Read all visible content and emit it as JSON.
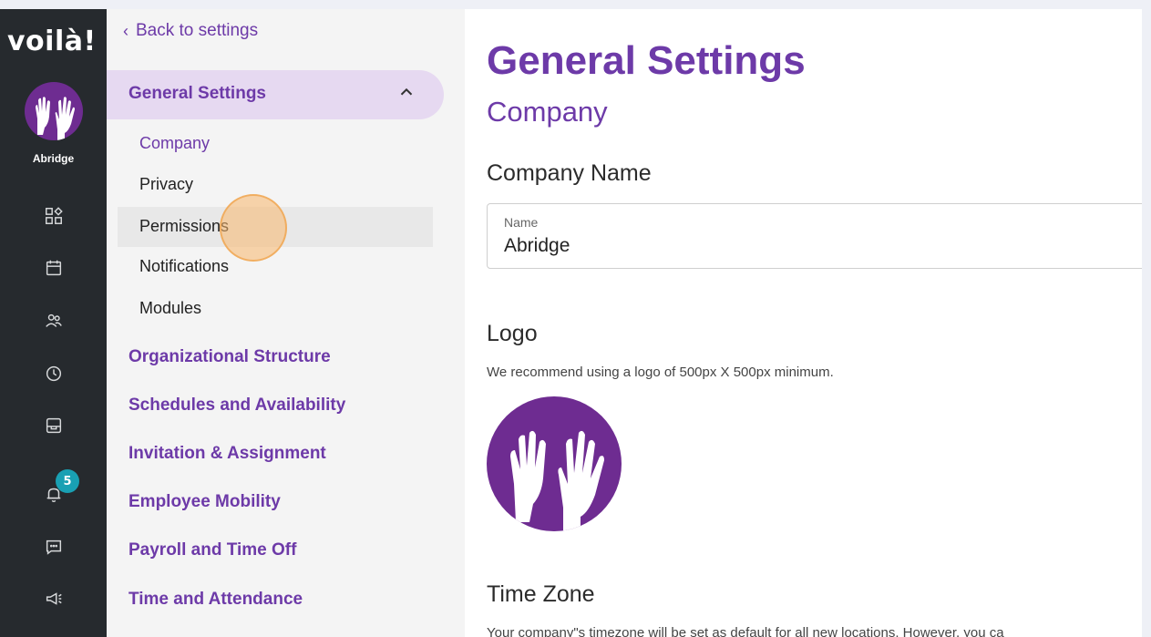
{
  "rail": {
    "logo_text": "voilà!",
    "company_short": "Abridge",
    "icons": [
      "dashboard-icon",
      "calendar-icon",
      "people-icon",
      "clock-icon",
      "inbox-icon",
      "bell-icon",
      "chat-icon",
      "megaphone-icon"
    ],
    "notification_count": "5"
  },
  "sidebar": {
    "back_label": "Back to settings",
    "group_title": "General Settings",
    "sub_items": [
      "Company",
      "Privacy",
      "Permissions",
      "Notifications",
      "Modules"
    ],
    "sections": [
      "Organizational Structure",
      "Schedules and Availability",
      "Invitation & Assignment",
      "Employee Mobility",
      "Payroll and Time Off",
      "Time and Attendance"
    ]
  },
  "main": {
    "page_title": "General Settings",
    "section_title": "Company",
    "company_name_heading": "Company Name",
    "name_field_label": "Name",
    "name_field_value": "Abridge",
    "logo_heading": "Logo",
    "logo_hint": "We recommend using a logo of 500px X 500px minimum.",
    "timezone_heading": "Time Zone",
    "timezone_hint": "Your company\"s timezone will be set as default for all new locations. However, you ca"
  },
  "colors": {
    "accent": "#6d3aa8",
    "rail_bg": "#262a2e",
    "badge": "#19a0b3",
    "logo_bg": "#6e2c91"
  }
}
